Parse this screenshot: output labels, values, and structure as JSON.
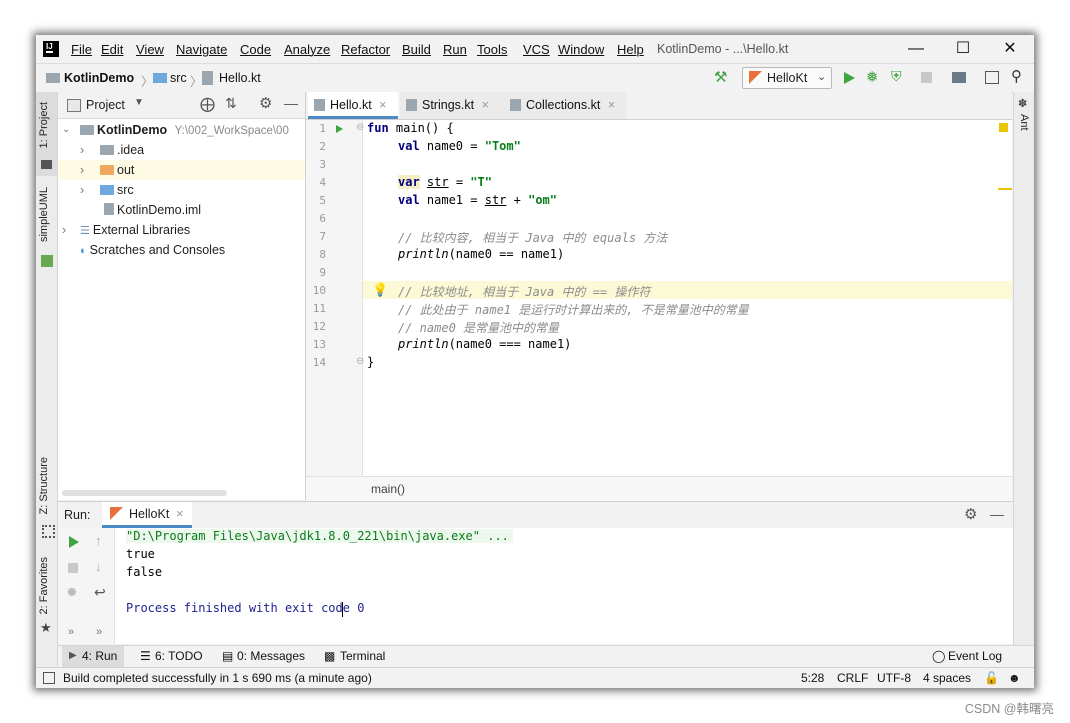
{
  "menu": [
    "File",
    "Edit",
    "View",
    "Navigate",
    "Code",
    "Analyze",
    "Refactor",
    "Build",
    "Run",
    "Tools",
    "VCS",
    "Window",
    "Help"
  ],
  "window_title": "KotlinDemo - ...\\Hello.kt",
  "nav": {
    "project": "KotlinDemo",
    "src": "src",
    "file": "Hello.kt",
    "run_config": "HelloKt"
  },
  "left_tabs": {
    "project": "1: Project",
    "uml": "simpleUML",
    "structure": "Z: Structure",
    "favorites": "2: Favorites"
  },
  "right_tabs": {
    "ant": "Ant"
  },
  "project_panel": {
    "title": "Project",
    "tree": [
      {
        "label": "KotlinDemo",
        "hint": "Y:\\002_WorkSpace\\00"
      },
      {
        "label": ".idea"
      },
      {
        "label": "out"
      },
      {
        "label": "src"
      },
      {
        "label": "KotlinDemo.iml"
      },
      {
        "label": "External Libraries"
      },
      {
        "label": "Scratches and Consoles"
      }
    ]
  },
  "editor_tabs": [
    {
      "label": "Hello.kt"
    },
    {
      "label": "Strings.kt"
    },
    {
      "label": "Collections.kt"
    }
  ],
  "code": {
    "line_numbers": [
      "1",
      "2",
      "3",
      "4",
      "5",
      "6",
      "7",
      "8",
      "9",
      "10",
      "11",
      "12",
      "13",
      "14"
    ],
    "l1_kw": "fun",
    "l1_rest": " main() {",
    "l2_kw": "val",
    "l2_mid": " name0 = ",
    "l2_str": "\"Tom\"",
    "l4_kw": "var",
    "l4_var": "str",
    "l4_mid": " = ",
    "l4_str": "\"T\"",
    "l5_kw": "val",
    "l5_mid": " name1 = ",
    "l5_var": "str",
    "l5_plus": " + ",
    "l5_str": "\"om\"",
    "l7": "// 比较内容, 相当于 Java 中的 equals 方法",
    "l8_fn": "println",
    "l8_rest": "(name0 == name1)",
    "l10": "// 比较地址, 相当于 Java 中的 == 操作符",
    "l11": "// 此处由于 name1 是运行时计算出来的, 不是常量池中的常量",
    "l12": "// name0 是常量池中的常量",
    "l13_fn": "println",
    "l13_rest": "(name0 === name1)",
    "l14": "}"
  },
  "editor_breadcrumb": "main()",
  "run_panel": {
    "label": "Run:",
    "tab": "HelloKt",
    "output": [
      "\"D:\\Program Files\\Java\\jdk1.8.0_221\\bin\\java.exe\" ...",
      "true",
      "false",
      "",
      "Process finished with exit code 0"
    ]
  },
  "tool_windows": {
    "run": "4: Run",
    "todo": "6: TODO",
    "messages": "0: Messages",
    "terminal": "Terminal",
    "event_log": "Event Log"
  },
  "status_bar": {
    "message": "Build completed successfully in 1 s 690 ms (a minute ago)",
    "position": "5:28",
    "line_sep": "CRLF",
    "encoding": "UTF-8",
    "indent": "4 spaces"
  },
  "watermark": "CSDN @韩曙亮",
  "colors": {
    "accent": "#4a88c7",
    "run_green": "#3fa33f",
    "keyword": "#000080",
    "string": "#067d17",
    "comment": "#8c8c8c"
  }
}
